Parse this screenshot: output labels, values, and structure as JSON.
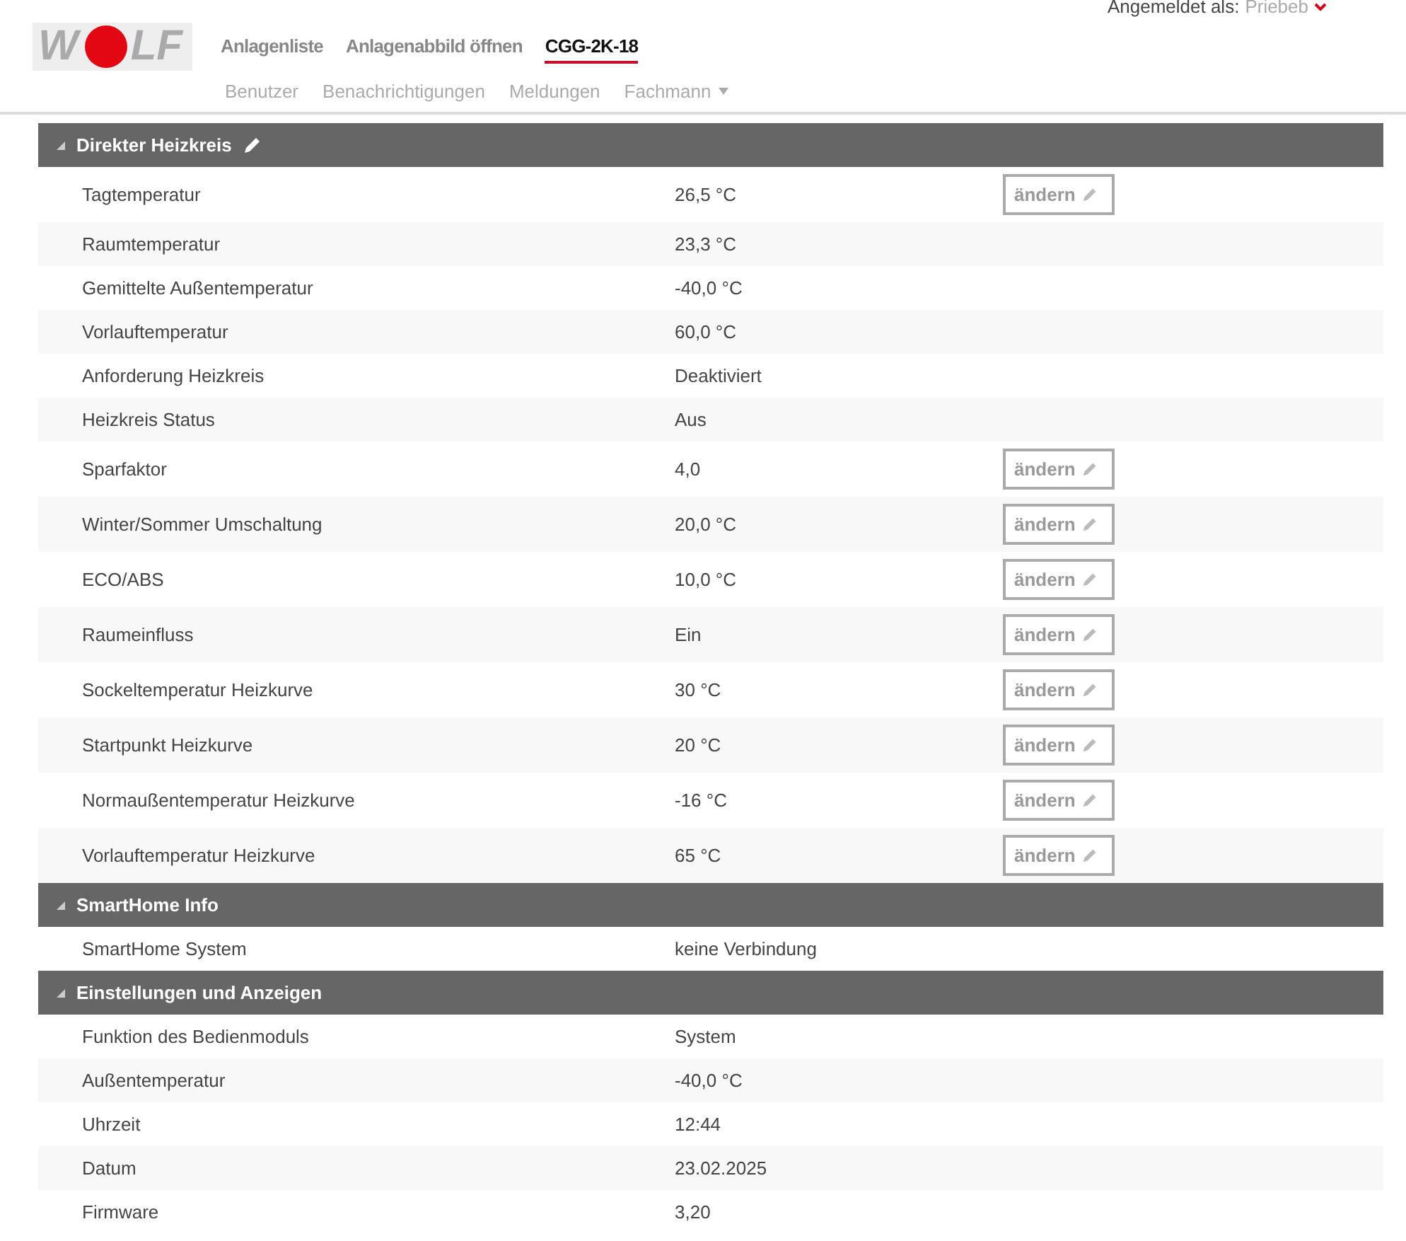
{
  "logo": {
    "left": "W",
    "right": "LF"
  },
  "user": {
    "label": "Angemeldet als:",
    "name": "Priebeb"
  },
  "nav": [
    {
      "label": "Anlagenliste",
      "selected": false
    },
    {
      "label": "Anlagenabbild öffnen",
      "selected": false
    },
    {
      "label": "CGG-2K-18",
      "selected": true
    }
  ],
  "subnav": [
    {
      "label": "Benutzer",
      "dropdown": false
    },
    {
      "label": "Benachrichtigungen",
      "dropdown": false
    },
    {
      "label": "Meldungen",
      "dropdown": false
    },
    {
      "label": "Fachmann",
      "dropdown": true
    }
  ],
  "sections": [
    {
      "title": "Direkter Heizkreis",
      "editable": true,
      "rows": [
        {
          "label": "Tagtemperatur",
          "value": "26,5 °C",
          "button": "ändern"
        },
        {
          "label": "Raumtemperatur",
          "value": "23,3 °C"
        },
        {
          "label": "Gemittelte Außentemperatur",
          "value": "-40,0 °C"
        },
        {
          "label": "Vorlauftemperatur",
          "value": "60,0 °C"
        },
        {
          "label": "Anforderung Heizkreis",
          "value": "Deaktiviert"
        },
        {
          "label": "Heizkreis Status",
          "value": "Aus"
        },
        {
          "label": "Sparfaktor",
          "value": "4,0",
          "button": "ändern"
        },
        {
          "label": "Winter/Sommer Umschaltung",
          "value": "20,0 °C",
          "button": "ändern"
        },
        {
          "label": "ECO/ABS",
          "value": "10,0 °C",
          "button": "ändern"
        },
        {
          "label": "Raumeinfluss",
          "value": "Ein",
          "button": "ändern"
        },
        {
          "label": "Sockeltemperatur Heizkurve",
          "value": "30 °C",
          "button": "ändern"
        },
        {
          "label": "Startpunkt Heizkurve",
          "value": "20 °C",
          "button": "ändern"
        },
        {
          "label": "Normaußentemperatur Heizkurve",
          "value": "-16 °C",
          "button": "ändern"
        },
        {
          "label": "Vorlauftemperatur Heizkurve",
          "value": "65 °C",
          "button": "ändern"
        }
      ]
    },
    {
      "title": "SmartHome Info",
      "editable": false,
      "rows": [
        {
          "label": "SmartHome System",
          "value": "keine Verbindung"
        }
      ]
    },
    {
      "title": "Einstellungen und Anzeigen",
      "editable": false,
      "rows": [
        {
          "label": "Funktion des Bedienmoduls",
          "value": "System"
        },
        {
          "label": "Außentemperatur",
          "value": "-40,0 °C"
        },
        {
          "label": "Uhrzeit",
          "value": "12:44"
        },
        {
          "label": "Datum",
          "value": "23.02.2025"
        },
        {
          "label": "Firmware",
          "value": "3,20"
        }
      ]
    }
  ]
}
